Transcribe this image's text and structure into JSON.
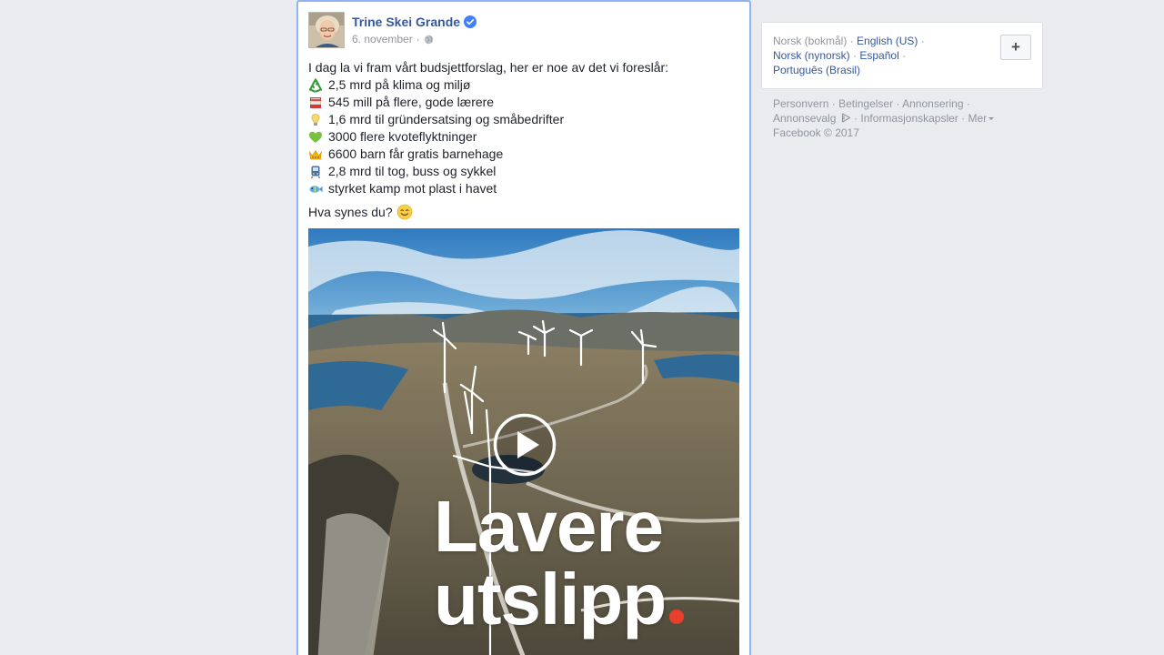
{
  "post": {
    "author": "Trine Skei Grande",
    "date": "6. november",
    "meta_separator": "·",
    "intro": "I dag la vi fram vårt budsjettforslag, her er noe av det vi foreslår:",
    "items": [
      {
        "icon": "recycle-icon",
        "text": "2,5 mrd på klima og miljø"
      },
      {
        "icon": "books-icon",
        "text": "545 mill på flere, gode lærere"
      },
      {
        "icon": "lightbulb-icon",
        "text": "1,6 mrd til gründersatsing og småbedrifter"
      },
      {
        "icon": "green-heart-icon",
        "text": "3000 flere kvoteflyktninger"
      },
      {
        "icon": "crown-icon",
        "text": "6600 barn får gratis barnehage"
      },
      {
        "icon": "train-icon",
        "text": "2,8 mrd til tog, buss og sykkel"
      },
      {
        "icon": "fish-icon",
        "text": "styrket kamp mot plast i havet"
      }
    ],
    "question": "Hva synes du?",
    "video": {
      "overlay_line1": "Lavere",
      "overlay_line2": "utslipp"
    }
  },
  "languages": {
    "current": "Norsk (bokmål)",
    "english": "English (US)",
    "nynorsk": "Norsk (nynorsk)",
    "spanish": "Español",
    "portuguese": "Português (Brasil)",
    "separator": "·",
    "add_label": "+"
  },
  "footer": {
    "privacy": "Personvern",
    "terms": "Betingelser",
    "advertising": "Annonsering",
    "ad_choices": "Annonsevalg",
    "cookies": "Informasjonskapsler",
    "more": "Mer",
    "copyright": "Facebook © 2017"
  },
  "colors": {
    "link": "#365899",
    "muted": "#90949c",
    "background": "#e9ebee",
    "focus_border": "#8fb3f5",
    "verified": "#4080ff",
    "accent_dot": "#e8402a"
  }
}
